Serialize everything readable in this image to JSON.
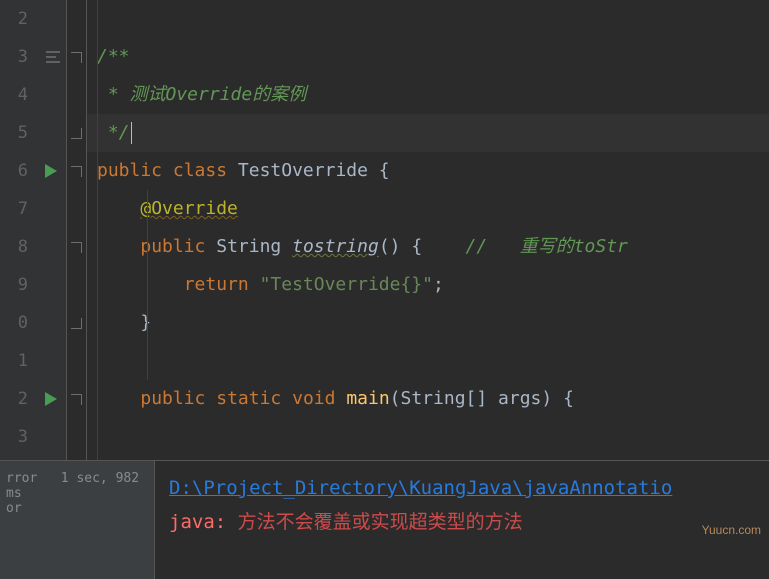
{
  "gutter": {
    "lines": [
      "2",
      "3",
      "4",
      "5",
      "6",
      "7",
      "8",
      "9",
      "0",
      "1",
      "2",
      "3"
    ]
  },
  "run_markers": {
    "on_lines": [
      4,
      10
    ]
  },
  "code": {
    "l0": "",
    "l1_a": "/**",
    "l2_a": " * 测试Override的案例",
    "l3_a": " */",
    "l4_kw1": "public",
    "l4_kw2": "class",
    "l4_name": "TestOverride",
    "l4_brace": " {",
    "l5_ann": "@Override",
    "l6_kw1": "public",
    "l6_type": "String",
    "l6_method": "tostring",
    "l6_rest": "() {    ",
    "l6_slash": "//",
    "l6_cmt": "   重写的toStr",
    "l7_kw": "return",
    "l7_str": "\"TestOverride{}\"",
    "l7_semi": ";",
    "l8_brace": "}",
    "l9": "",
    "l10_kw1": "public",
    "l10_kw2": "static",
    "l10_kw3": "void",
    "l10_method": "main",
    "l10_rest": "(String[] args) {",
    "l11": ""
  },
  "console": {
    "left_line1": "rror",
    "left_time": "1 sec, 982 ms",
    "left_line2": "or",
    "path": "D:\\Project_Directory\\KuangJava\\javaAnnotatio",
    "err_prefix": "java: ",
    "err_msg": "方法不会覆盖或实现超类型的方法"
  },
  "watermark": "Yuucn.com"
}
